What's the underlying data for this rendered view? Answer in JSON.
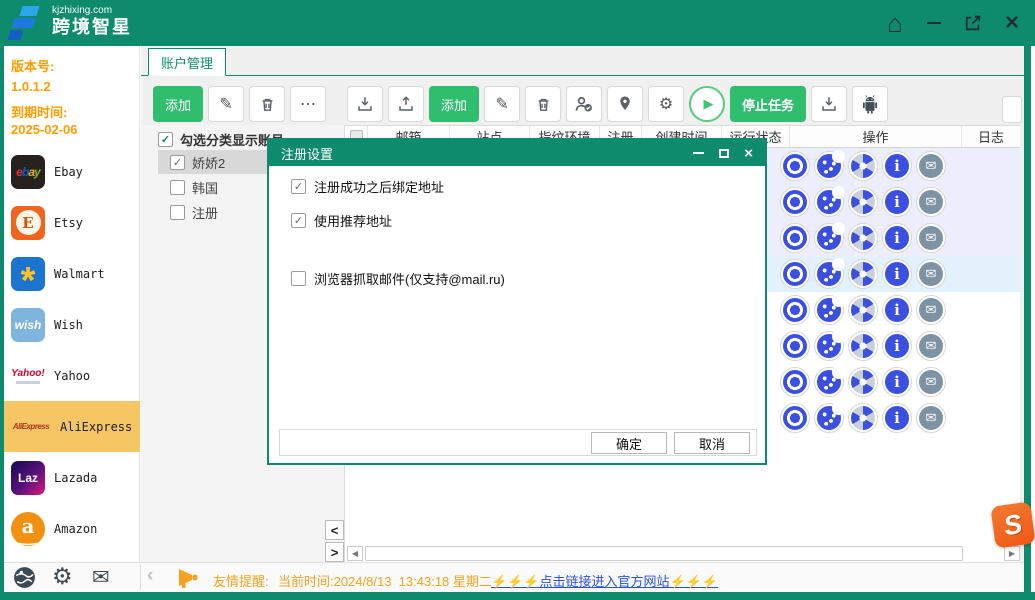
{
  "window": {
    "brand_domain": "kjzhixing.com",
    "brand_name": "跨境智星"
  },
  "colors": {
    "teal": "#0e8b6c",
    "green_button": "#2fbe6d",
    "orange_text": "#ff9d00",
    "status_orange": "#f5a21f",
    "link_blue": "#2b50e8",
    "action_blue": "#3b4fe0",
    "mail_gray": "#7d93a3",
    "row_lavender": "#eceffb",
    "row_selected": "#e2f1fc",
    "platform_selected_bg": "#f6c664",
    "ebay_letters": [
      "#e53238",
      "#0064d2",
      "#f5af02",
      "#86b817"
    ]
  },
  "icons": {
    "home": "⌂",
    "close": "×",
    "gear": "⚙",
    "pencil": "✎",
    "dots": "⋯",
    "play": "▶",
    "envelope": "✉",
    "check": "✓",
    "info": "i",
    "scroll_left": "◀",
    "scroll_right": "▶",
    "collapse_left": "<",
    "expand_right": ">",
    "chevron_left": "‹",
    "amazon_smile": "‿"
  },
  "license": {
    "version_label": "版本号:",
    "version": "1.0.1.2",
    "expire_label": "到期时间:",
    "expire_date": "2025-02-06"
  },
  "sidebar": {
    "platforms": [
      {
        "name": "Ebay",
        "icon_text": "ebay"
      },
      {
        "name": "Etsy",
        "icon_text": "E"
      },
      {
        "name": "Walmart",
        "icon_text": "*"
      },
      {
        "name": "Wish",
        "icon_text": "wish"
      },
      {
        "name": "Yahoo",
        "icon_text": "Yahoo!"
      },
      {
        "name": "AliExpress",
        "icon_text": "AliExpress",
        "selected": true
      },
      {
        "name": "Lazada",
        "icon_text": "Laz"
      },
      {
        "name": "Amazon",
        "icon_text": "a"
      }
    ]
  },
  "tabs": {
    "account": "账户管理"
  },
  "tree": {
    "toolbar": {
      "add": "添加"
    },
    "header": "勾选分类显示账号",
    "items": [
      {
        "label": "娇娇2",
        "checked": true,
        "selected": true
      },
      {
        "label": "韩国",
        "checked": false
      },
      {
        "label": "注册",
        "checked": false
      }
    ]
  },
  "toolbar": {
    "add": "添加",
    "stop": "停止任务"
  },
  "table": {
    "headers": [
      "邮箱",
      "站点",
      "指纹环境",
      "注册",
      "创建时间",
      "运行状态",
      "操作",
      "日志"
    ],
    "action_icons": [
      "chrome",
      "cookie",
      "fan",
      "info",
      "mail"
    ],
    "rows": [
      {
        "variant": "lavender"
      },
      {
        "variant": "lavender"
      },
      {
        "variant": "lavender"
      },
      {
        "variant": "highlight"
      },
      {
        "variant": "plain"
      },
      {
        "variant": "plain"
      },
      {
        "variant": "plain"
      },
      {
        "variant": "plain"
      }
    ]
  },
  "dialog": {
    "title": "注册设置",
    "options": [
      {
        "label": "注册成功之后绑定地址",
        "checked": true
      },
      {
        "label": "使用推荐地址",
        "checked": true
      },
      {
        "label": "浏览器抓取邮件(仅支持@mail.ru)",
        "checked": false
      }
    ],
    "ok": "确定",
    "cancel": "取消"
  },
  "statusbar": {
    "notice_label": "友情提醒:",
    "time_text": "当前时间:2024/8/13  13:43:18 星期二",
    "link_text": "⚡⚡⚡点击链接进入官方网站⚡⚡⚡"
  },
  "overlay": {
    "s_logo_text": "S"
  }
}
